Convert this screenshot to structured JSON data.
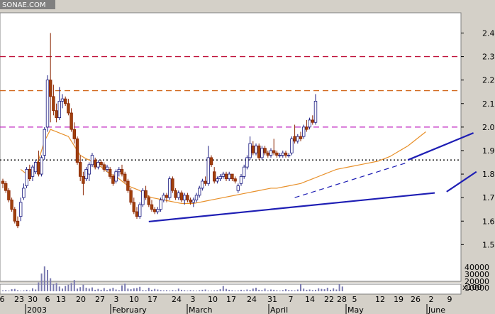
{
  "chart_data": {
    "type": "candlestick",
    "title": "SONAE.COM",
    "price_axis": {
      "ylim": [
        1.35,
        2.48
      ],
      "ticks": [
        "2.4",
        "2.3",
        "2.2",
        "2.1",
        "2.0",
        "1.9",
        "1.8",
        "1.7",
        "1.6",
        "1.5"
      ]
    },
    "volume_axis": {
      "ylim": [
        0,
        48000
      ],
      "ticks": [
        "40000",
        "30000",
        "20000",
        "10000"
      ],
      "unit_label": "x100"
    },
    "x_day_ticks": [
      "6",
      "23",
      "30",
      "6",
      "13",
      "20",
      "27",
      "3",
      "10",
      "17",
      "24",
      "3",
      "10",
      "17",
      "24",
      "31",
      "7",
      "14",
      "22",
      "28",
      "5",
      "12",
      "19",
      "26",
      "2",
      "9"
    ],
    "x_months": [
      "2003",
      "February",
      "March",
      "April",
      "May",
      "June"
    ],
    "horizontal_lines": [
      {
        "value": 2.3,
        "color": "#c0143c",
        "style": "dashed"
      },
      {
        "value": 2.155,
        "color": "#d2691e",
        "style": "dashed"
      },
      {
        "value": 2.0,
        "color": "#c026c0",
        "style": "dashed"
      },
      {
        "value": 1.86,
        "color": "#000000",
        "style": "dotted"
      }
    ],
    "trendlines": [
      {
        "x": [
          49,
          145
        ],
        "y": [
          1.598,
          1.72
        ],
        "color": "#1e1eb4",
        "style": "solid"
      },
      {
        "x": [
          149,
          159
        ],
        "y": [
          1.725,
          1.81
        ],
        "color": "#1e1eb4",
        "style": "solid"
      },
      {
        "x": [
          98,
          136
        ],
        "y": [
          1.7,
          1.85
        ],
        "color": "#1e1eb4",
        "style": "dashed"
      },
      {
        "x": [
          136,
          158
        ],
        "y": [
          1.86,
          1.975
        ],
        "color": "#1e1eb4",
        "style": "solid"
      }
    ],
    "moving_average": {
      "color": "#e8902a",
      "points": [
        [
          6,
          1.82
        ],
        [
          8,
          1.8
        ],
        [
          10,
          1.82
        ],
        [
          12,
          1.86
        ],
        [
          14,
          1.94
        ],
        [
          16,
          1.99
        ],
        [
          18,
          1.98
        ],
        [
          20,
          1.97
        ],
        [
          22,
          1.96
        ],
        [
          24,
          1.92
        ],
        [
          26,
          1.88
        ],
        [
          28,
          1.865
        ],
        [
          30,
          1.855
        ],
        [
          32,
          1.84
        ],
        [
          34,
          1.82
        ],
        [
          36,
          1.8
        ],
        [
          38,
          1.79
        ],
        [
          40,
          1.77
        ],
        [
          42,
          1.75
        ],
        [
          44,
          1.74
        ],
        [
          46,
          1.73
        ],
        [
          48,
          1.71
        ],
        [
          50,
          1.7
        ],
        [
          52,
          1.695
        ],
        [
          54,
          1.69
        ],
        [
          56,
          1.685
        ],
        [
          58,
          1.68
        ],
        [
          60,
          1.675
        ],
        [
          62,
          1.675
        ],
        [
          64,
          1.675
        ],
        [
          66,
          1.68
        ],
        [
          68,
          1.685
        ],
        [
          70,
          1.69
        ],
        [
          72,
          1.695
        ],
        [
          74,
          1.7
        ],
        [
          76,
          1.705
        ],
        [
          78,
          1.71
        ],
        [
          80,
          1.715
        ],
        [
          82,
          1.72
        ],
        [
          84,
          1.725
        ],
        [
          86,
          1.73
        ],
        [
          88,
          1.735
        ],
        [
          90,
          1.74
        ],
        [
          92,
          1.74
        ],
        [
          94,
          1.745
        ],
        [
          96,
          1.75
        ],
        [
          98,
          1.755
        ],
        [
          100,
          1.76
        ],
        [
          102,
          1.77
        ],
        [
          104,
          1.78
        ],
        [
          106,
          1.79
        ],
        [
          108,
          1.8
        ],
        [
          110,
          1.81
        ],
        [
          112,
          1.82
        ],
        [
          114,
          1.825
        ],
        [
          116,
          1.83
        ],
        [
          118,
          1.835
        ],
        [
          120,
          1.84
        ],
        [
          122,
          1.845
        ],
        [
          124,
          1.85
        ],
        [
          126,
          1.855
        ],
        [
          128,
          1.865
        ],
        [
          130,
          1.875
        ],
        [
          132,
          1.89
        ],
        [
          134,
          1.905
        ],
        [
          136,
          1.92
        ],
        [
          138,
          1.94
        ],
        [
          140,
          1.96
        ],
        [
          142,
          1.98
        ]
      ]
    },
    "candles": [
      {
        "o": 1.77,
        "h": 1.78,
        "l": 1.74,
        "c": 1.76
      },
      {
        "o": 1.76,
        "h": 1.77,
        "l": 1.72,
        "c": 1.73
      },
      {
        "o": 1.73,
        "h": 1.74,
        "l": 1.68,
        "c": 1.69
      },
      {
        "o": 1.69,
        "h": 1.7,
        "l": 1.64,
        "c": 1.65
      },
      {
        "o": 1.65,
        "h": 1.66,
        "l": 1.59,
        "c": 1.6
      },
      {
        "o": 1.6,
        "h": 1.62,
        "l": 1.57,
        "c": 1.58
      },
      {
        "o": 1.62,
        "h": 1.7,
        "l": 1.6,
        "c": 1.68
      },
      {
        "o": 1.7,
        "h": 1.76,
        "l": 1.69,
        "c": 1.74
      },
      {
        "o": 1.75,
        "h": 1.83,
        "l": 1.74,
        "c": 1.82
      },
      {
        "o": 1.82,
        "h": 1.84,
        "l": 1.77,
        "c": 1.78
      },
      {
        "o": 1.79,
        "h": 1.84,
        "l": 1.77,
        "c": 1.83
      },
      {
        "o": 1.81,
        "h": 1.86,
        "l": 1.8,
        "c": 1.85
      },
      {
        "o": 1.85,
        "h": 1.9,
        "l": 1.79,
        "c": 1.8
      },
      {
        "o": 1.8,
        "h": 1.88,
        "l": 1.79,
        "c": 1.87
      },
      {
        "o": 1.88,
        "h": 2.0,
        "l": 1.86,
        "c": 1.99
      },
      {
        "o": 2.0,
        "h": 2.22,
        "l": 1.98,
        "c": 2.2
      },
      {
        "o": 2.2,
        "h": 2.4,
        "l": 2.02,
        "c": 2.13
      },
      {
        "o": 2.13,
        "h": 2.18,
        "l": 2.05,
        "c": 2.07
      },
      {
        "o": 2.07,
        "h": 2.1,
        "l": 2.02,
        "c": 2.04
      },
      {
        "o": 2.04,
        "h": 2.17,
        "l": 2.03,
        "c": 2.11
      },
      {
        "o": 2.11,
        "h": 2.14,
        "l": 2.08,
        "c": 2.12
      },
      {
        "o": 2.12,
        "h": 2.13,
        "l": 2.09,
        "c": 2.1
      },
      {
        "o": 2.1,
        "h": 2.12,
        "l": 2.05,
        "c": 2.06
      },
      {
        "o": 2.06,
        "h": 2.08,
        "l": 1.98,
        "c": 1.99
      },
      {
        "o": 1.99,
        "h": 2.02,
        "l": 1.93,
        "c": 1.95
      },
      {
        "o": 1.95,
        "h": 1.96,
        "l": 1.84,
        "c": 1.85
      },
      {
        "o": 1.85,
        "h": 1.88,
        "l": 1.77,
        "c": 1.79
      },
      {
        "o": 1.79,
        "h": 1.81,
        "l": 1.71,
        "c": 1.76
      },
      {
        "o": 1.78,
        "h": 1.83,
        "l": 1.77,
        "c": 1.82
      },
      {
        "o": 1.8,
        "h": 1.85,
        "l": 1.77,
        "c": 1.84
      },
      {
        "o": 1.84,
        "h": 1.89,
        "l": 1.83,
        "c": 1.88
      },
      {
        "o": 1.86,
        "h": 1.87,
        "l": 1.82,
        "c": 1.83
      },
      {
        "o": 1.83,
        "h": 1.86,
        "l": 1.82,
        "c": 1.85
      },
      {
        "o": 1.85,
        "h": 1.86,
        "l": 1.83,
        "c": 1.84
      },
      {
        "o": 1.84,
        "h": 1.85,
        "l": 1.81,
        "c": 1.82
      },
      {
        "o": 1.82,
        "h": 1.84,
        "l": 1.81,
        "c": 1.83
      },
      {
        "o": 1.82,
        "h": 1.83,
        "l": 1.78,
        "c": 1.79
      },
      {
        "o": 1.79,
        "h": 1.8,
        "l": 1.75,
        "c": 1.76
      },
      {
        "o": 1.77,
        "h": 1.82,
        "l": 1.76,
        "c": 1.81
      },
      {
        "o": 1.81,
        "h": 1.83,
        "l": 1.79,
        "c": 1.82
      },
      {
        "o": 1.82,
        "h": 1.84,
        "l": 1.79,
        "c": 1.8
      },
      {
        "o": 1.8,
        "h": 1.81,
        "l": 1.76,
        "c": 1.77
      },
      {
        "o": 1.77,
        "h": 1.78,
        "l": 1.72,
        "c": 1.73
      },
      {
        "o": 1.73,
        "h": 1.74,
        "l": 1.67,
        "c": 1.68
      },
      {
        "o": 1.68,
        "h": 1.7,
        "l": 1.63,
        "c": 1.64
      },
      {
        "o": 1.64,
        "h": 1.66,
        "l": 1.61,
        "c": 1.62
      },
      {
        "o": 1.62,
        "h": 1.68,
        "l": 1.61,
        "c": 1.67
      },
      {
        "o": 1.67,
        "h": 1.74,
        "l": 1.66,
        "c": 1.73
      },
      {
        "o": 1.73,
        "h": 1.75,
        "l": 1.69,
        "c": 1.7
      },
      {
        "o": 1.7,
        "h": 1.71,
        "l": 1.66,
        "c": 1.67
      },
      {
        "o": 1.67,
        "h": 1.69,
        "l": 1.64,
        "c": 1.65
      },
      {
        "o": 1.65,
        "h": 1.66,
        "l": 1.63,
        "c": 1.64
      },
      {
        "o": 1.64,
        "h": 1.66,
        "l": 1.63,
        "c": 1.65
      },
      {
        "o": 1.65,
        "h": 1.7,
        "l": 1.64,
        "c": 1.69
      },
      {
        "o": 1.69,
        "h": 1.72,
        "l": 1.68,
        "c": 1.71
      },
      {
        "o": 1.71,
        "h": 1.72,
        "l": 1.68,
        "c": 1.7
      },
      {
        "o": 1.7,
        "h": 1.79,
        "l": 1.69,
        "c": 1.78
      },
      {
        "o": 1.78,
        "h": 1.79,
        "l": 1.72,
        "c": 1.73
      },
      {
        "o": 1.73,
        "h": 1.74,
        "l": 1.69,
        "c": 1.7
      },
      {
        "o": 1.7,
        "h": 1.73,
        "l": 1.69,
        "c": 1.72
      },
      {
        "o": 1.72,
        "h": 1.73,
        "l": 1.68,
        "c": 1.69
      },
      {
        "o": 1.69,
        "h": 1.72,
        "l": 1.67,
        "c": 1.71
      },
      {
        "o": 1.71,
        "h": 1.72,
        "l": 1.68,
        "c": 1.69
      },
      {
        "o": 1.69,
        "h": 1.7,
        "l": 1.67,
        "c": 1.68
      },
      {
        "o": 1.68,
        "h": 1.7,
        "l": 1.66,
        "c": 1.69
      },
      {
        "o": 1.69,
        "h": 1.72,
        "l": 1.68,
        "c": 1.71
      },
      {
        "o": 1.71,
        "h": 1.75,
        "l": 1.7,
        "c": 1.74
      },
      {
        "o": 1.74,
        "h": 1.78,
        "l": 1.73,
        "c": 1.77
      },
      {
        "o": 1.77,
        "h": 1.79,
        "l": 1.75,
        "c": 1.76
      },
      {
        "o": 1.76,
        "h": 1.92,
        "l": 1.75,
        "c": 1.87
      },
      {
        "o": 1.87,
        "h": 1.88,
        "l": 1.83,
        "c": 1.84
      },
      {
        "o": 1.81,
        "h": 1.83,
        "l": 1.76,
        "c": 1.77
      },
      {
        "o": 1.77,
        "h": 1.79,
        "l": 1.76,
        "c": 1.78
      },
      {
        "o": 1.78,
        "h": 1.8,
        "l": 1.77,
        "c": 1.79
      },
      {
        "o": 1.79,
        "h": 1.81,
        "l": 1.78,
        "c": 1.8
      },
      {
        "o": 1.8,
        "h": 1.81,
        "l": 1.77,
        "c": 1.78
      },
      {
        "o": 1.78,
        "h": 1.81,
        "l": 1.77,
        "c": 1.8
      },
      {
        "o": 1.8,
        "h": 1.8,
        "l": 1.77,
        "c": 1.78
      },
      {
        "o": 1.78,
        "h": 1.79,
        "l": 1.76,
        "c": 1.77
      },
      {
        "o": 1.73,
        "h": 1.76,
        "l": 1.72,
        "c": 1.75
      },
      {
        "o": 1.76,
        "h": 1.8,
        "l": 1.75,
        "c": 1.79
      },
      {
        "o": 1.79,
        "h": 1.84,
        "l": 1.78,
        "c": 1.83
      },
      {
        "o": 1.83,
        "h": 1.88,
        "l": 1.82,
        "c": 1.87
      },
      {
        "o": 1.87,
        "h": 1.96,
        "l": 1.86,
        "c": 1.93
      },
      {
        "o": 1.92,
        "h": 1.94,
        "l": 1.88,
        "c": 1.89
      },
      {
        "o": 1.89,
        "h": 1.93,
        "l": 1.88,
        "c": 1.92
      },
      {
        "o": 1.92,
        "h": 1.93,
        "l": 1.86,
        "c": 1.87
      },
      {
        "o": 1.87,
        "h": 1.92,
        "l": 1.86,
        "c": 1.91
      },
      {
        "o": 1.91,
        "h": 1.92,
        "l": 1.88,
        "c": 1.89
      },
      {
        "o": 1.89,
        "h": 1.9,
        "l": 1.87,
        "c": 1.88
      },
      {
        "o": 1.88,
        "h": 1.91,
        "l": 1.87,
        "c": 1.9
      },
      {
        "o": 1.9,
        "h": 1.95,
        "l": 1.88,
        "c": 1.89
      },
      {
        "o": 1.89,
        "h": 1.9,
        "l": 1.87,
        "c": 1.88
      },
      {
        "o": 1.88,
        "h": 1.89,
        "l": 1.87,
        "c": 1.88
      },
      {
        "o": 1.88,
        "h": 1.9,
        "l": 1.87,
        "c": 1.89
      },
      {
        "o": 1.89,
        "h": 1.9,
        "l": 1.87,
        "c": 1.88
      },
      {
        "o": 1.88,
        "h": 1.89,
        "l": 1.87,
        "c": 1.88
      },
      {
        "o": 1.89,
        "h": 1.96,
        "l": 1.88,
        "c": 1.95
      },
      {
        "o": 1.96,
        "h": 2.01,
        "l": 1.93,
        "c": 1.94
      },
      {
        "o": 1.94,
        "h": 1.97,
        "l": 1.93,
        "c": 1.96
      },
      {
        "o": 1.96,
        "h": 1.98,
        "l": 1.94,
        "c": 1.95
      },
      {
        "o": 1.96,
        "h": 2.01,
        "l": 1.95,
        "c": 2.0
      },
      {
        "o": 2.0,
        "h": 2.03,
        "l": 1.98,
        "c": 1.99
      },
      {
        "o": 2.0,
        "h": 2.04,
        "l": 1.99,
        "c": 2.03
      },
      {
        "o": 2.03,
        "h": 2.05,
        "l": 2.01,
        "c": 2.02
      },
      {
        "o": 2.02,
        "h": 2.14,
        "l": 2.01,
        "c": 2.11
      }
    ],
    "volumes": [
      1500,
      2000,
      1200,
      3500,
      4000,
      1800,
      900,
      1500,
      2500,
      1200,
      5000,
      3000,
      15000,
      30000,
      42000,
      36000,
      22000,
      12000,
      14000,
      8000,
      4500,
      9000,
      11000,
      14000,
      19000,
      4500,
      7000,
      11000,
      6000,
      4500,
      6500,
      2500,
      4000,
      2500,
      5500,
      2000,
      4000,
      6000,
      3000,
      1800,
      10000,
      13000,
      4500,
      3500,
      5000,
      5500,
      7500,
      2000,
      1800,
      6000,
      2500,
      4000,
      3000,
      2000,
      1500,
      1800,
      1200,
      2000,
      1500,
      4500,
      2500,
      1800,
      1200,
      2000,
      1500,
      1000,
      1800,
      2500,
      3000,
      1200,
      1000,
      1500,
      2000,
      3500,
      9000,
      4000,
      2500,
      1800,
      1200,
      1500,
      2500,
      1500,
      3000,
      2000,
      4500,
      6000,
      2500,
      2000,
      4500,
      1500,
      3000,
      2500,
      1800,
      1200,
      2000,
      3500,
      2000,
      2000,
      1500,
      3000,
      12000,
      4500,
      2500,
      3000,
      2000,
      2500,
      5000,
      4000,
      3500,
      6000,
      2500,
      5000,
      3000,
      12000,
      8000
    ]
  }
}
